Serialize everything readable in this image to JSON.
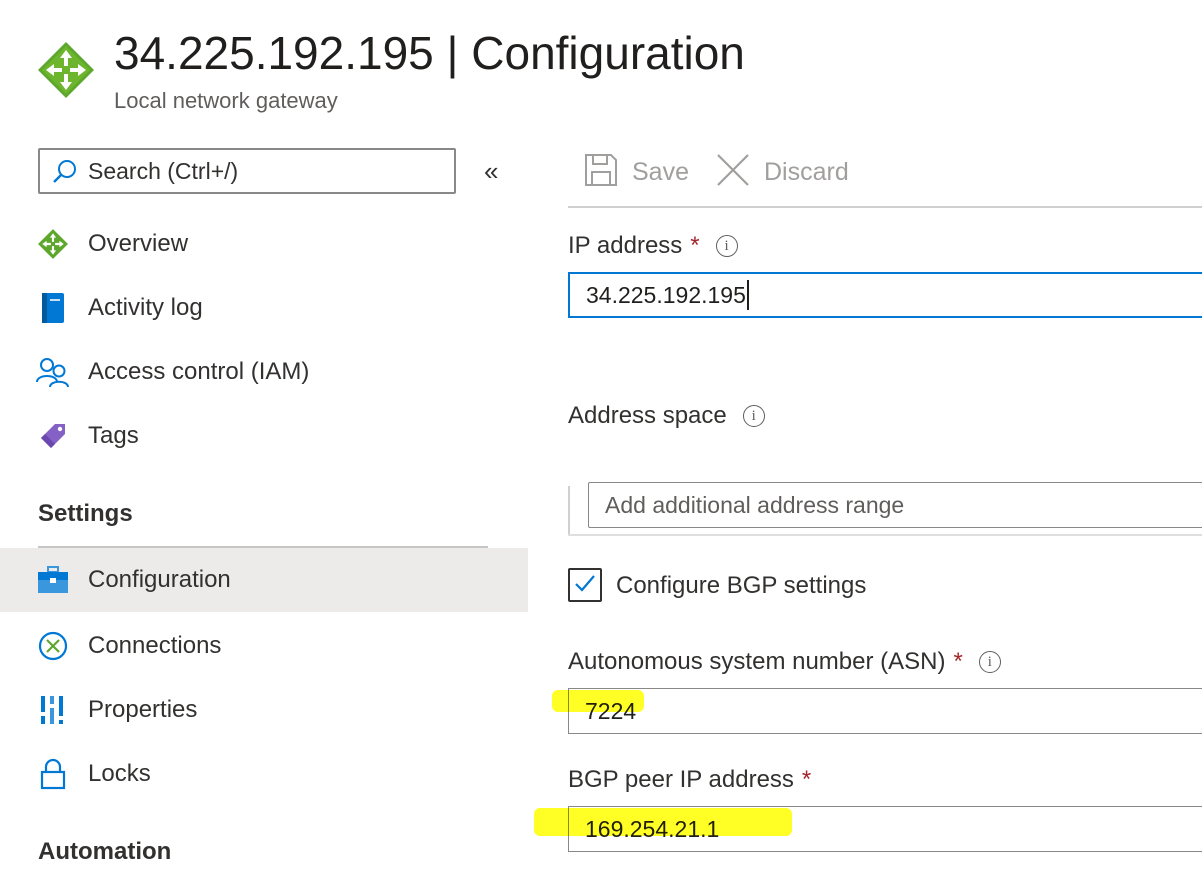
{
  "header": {
    "title": "34.225.192.195 | Configuration",
    "subtitle": "Local network gateway",
    "icon": "local-network-gateway-icon"
  },
  "sidebar": {
    "search_placeholder": "Search (Ctrl+/)",
    "collapse_glyph": "«",
    "items": [
      {
        "label": "Overview",
        "icon": "overview-icon"
      },
      {
        "label": "Activity log",
        "icon": "activity-log-icon"
      },
      {
        "label": "Access control (IAM)",
        "icon": "access-control-icon"
      },
      {
        "label": "Tags",
        "icon": "tag-icon"
      }
    ],
    "settings_header": "Settings",
    "settings_items": [
      {
        "label": "Configuration",
        "icon": "configuration-icon",
        "selected": true
      },
      {
        "label": "Connections",
        "icon": "connections-icon"
      },
      {
        "label": "Properties",
        "icon": "properties-icon"
      },
      {
        "label": "Locks",
        "icon": "lock-icon"
      }
    ],
    "automation_header": "Automation"
  },
  "toolbar": {
    "save_label": "Save",
    "discard_label": "Discard"
  },
  "form": {
    "ip_label": "IP address",
    "ip_value": "34.225.192.195",
    "address_space_label": "Address space",
    "address_range_placeholder": "Add additional address range",
    "bgp_checkbox_label": "Configure BGP settings",
    "bgp_checked": true,
    "asn_label": "Autonomous system number (ASN)",
    "asn_value": "7224",
    "bgp_peer_label": "BGP peer IP address",
    "bgp_peer_value": "169.254.21.1",
    "required_mark": "*",
    "info_glyph": "i"
  },
  "colors": {
    "accent": "#0078d4",
    "required": "#a4262c",
    "highlight": "#ffff00",
    "selected_bg": "#edebe9"
  }
}
